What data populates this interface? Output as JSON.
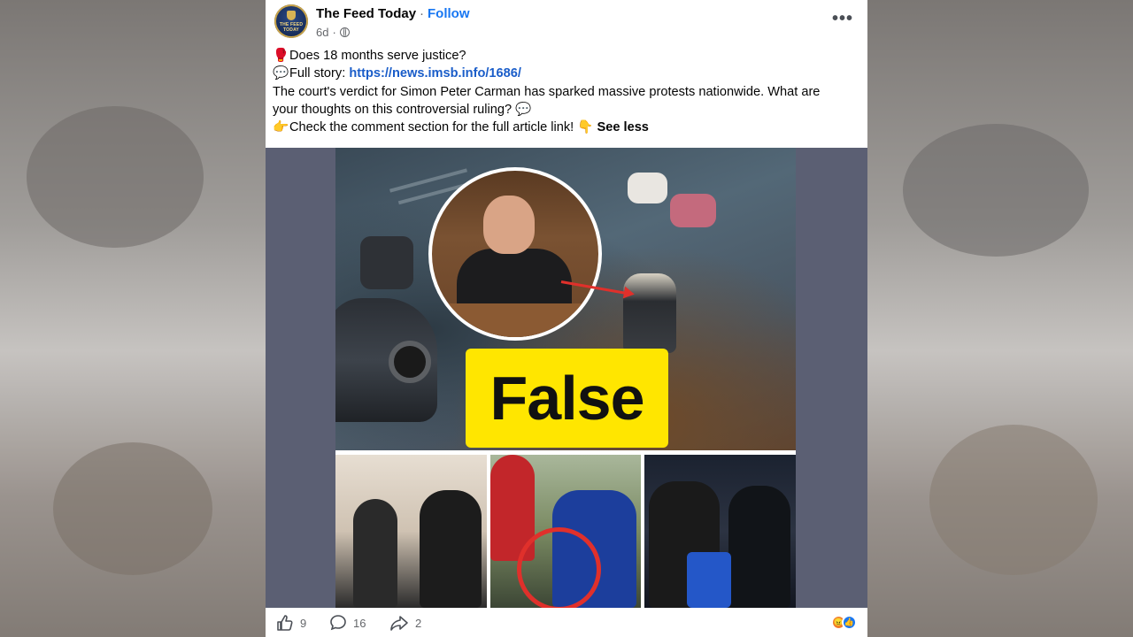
{
  "post": {
    "page_name": "The Feed Today",
    "follow_label": "Follow",
    "avatar_text": "THE FEED TODAY",
    "time": "6d",
    "more_label": "•••",
    "lines": {
      "q_emoji": "🥊",
      "question": "Does 18 months serve justice?",
      "story_emoji": "💬",
      "story_prefix": "Full story:",
      "story_link": "https://news.imsb.info/1686/",
      "body_1": "The court's verdict for Simon Peter Carman has sparked massive protests nationwide. What are",
      "body_2": "your thoughts on this controversial ruling?",
      "body_2_emoji": "💬",
      "cta_emoji": "👉",
      "cta": "Check the comment section for the full article link!",
      "cta_emoji_2": "👇",
      "see_less": "See less"
    }
  },
  "media": {
    "badge": "False"
  },
  "actions": {
    "likes": "9",
    "comments": "16",
    "shares": "2"
  },
  "icons": {
    "like": "thumbs-up-icon",
    "comment": "comment-bubble-icon",
    "share": "share-arrow-icon",
    "reaction_angry": "angry-reaction-icon",
    "reaction_like": "like-reaction-icon"
  },
  "colors": {
    "link": "#1a5dc9",
    "follow": "#1877f2",
    "badge_bg": "#ffe600"
  }
}
